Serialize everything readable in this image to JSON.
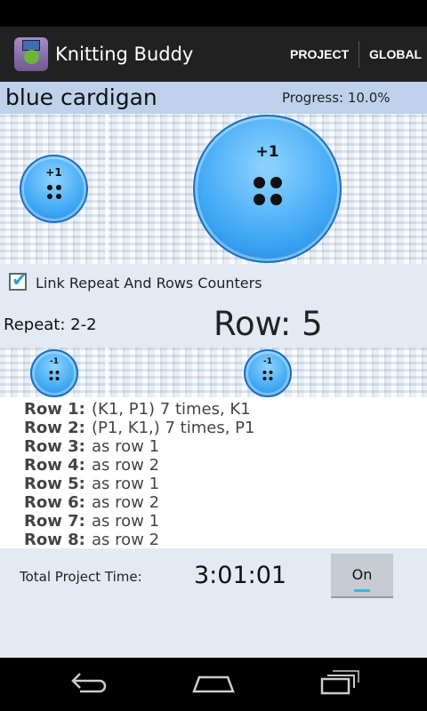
{
  "app": {
    "title": "Knitting Buddy",
    "tabs": [
      "PROJECT",
      "GLOBAL"
    ]
  },
  "project": {
    "name": "blue cardigan",
    "progress": "Progress: 10.0%"
  },
  "counters": {
    "repeat_plus": "+1",
    "row_plus": "+1",
    "repeat_minus": "-1",
    "row_minus": "-1"
  },
  "link": {
    "label": "Link Repeat And Rows Counters",
    "checked": true
  },
  "repeat_label": "Repeat: 2-2",
  "row_label": "Row: 5",
  "pattern": [
    {
      "row": "Row 1:",
      "text": "(K1, P1) 7 times, K1"
    },
    {
      "row": "Row 2:",
      "text": "(P1, K1,) 7 times, P1"
    },
    {
      "row": "Row 3:",
      "text": "as row 1"
    },
    {
      "row": "Row 4:",
      "text": "as row 2"
    },
    {
      "row": "Row 5:",
      "text": "as row 1"
    },
    {
      "row": "Row 6:",
      "text": "as row 2"
    },
    {
      "row": "Row 7:",
      "text": "as row 1"
    },
    {
      "row": "Row 8:",
      "text": "as row 2"
    }
  ],
  "timer": {
    "label": "Total Project Time:",
    "value": "3:01:01",
    "button": "On"
  },
  "accent": "#33b5e5"
}
